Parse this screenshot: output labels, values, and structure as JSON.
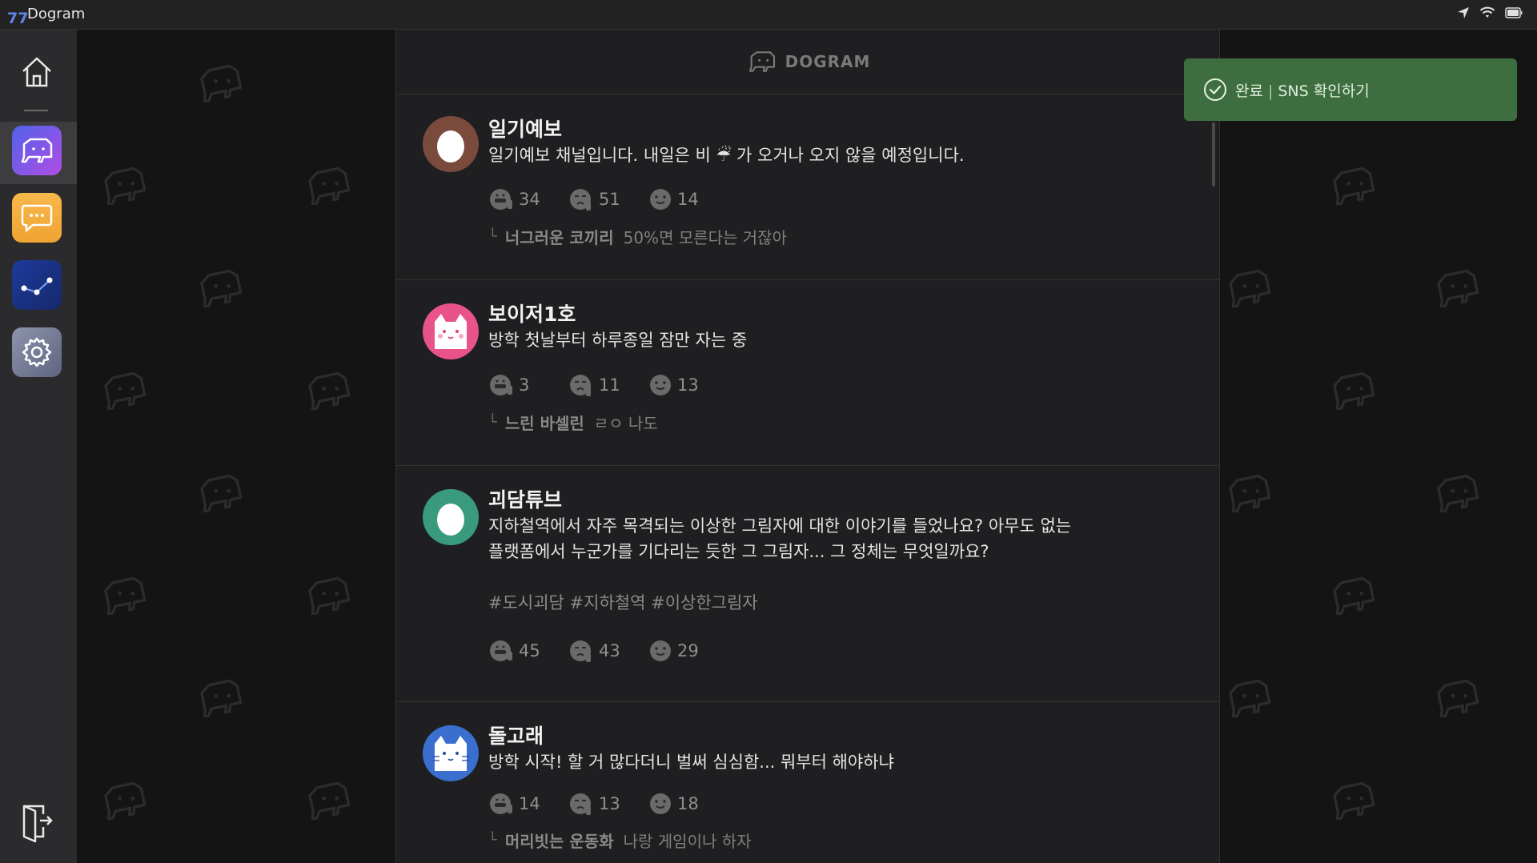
{
  "app": {
    "number": "77",
    "title": "Dogram"
  },
  "status_icons": [
    "location-arrow-icon",
    "wifi-icon",
    "battery-icon"
  ],
  "sidebar": {
    "items": [
      {
        "name": "home",
        "icon": "home-icon"
      },
      {
        "name": "dogram",
        "icon": "dogram-logo-icon",
        "active": true
      },
      {
        "name": "chat",
        "icon": "chat-bubble-icon"
      },
      {
        "name": "constellation",
        "icon": "constellation-icon"
      },
      {
        "name": "settings",
        "icon": "gear-icon"
      },
      {
        "name": "exit",
        "icon": "exit-door-icon"
      }
    ]
  },
  "feed": {
    "logo_text": "DOGRAM",
    "posts": [
      {
        "name": "일기예보",
        "text": "일기예보 채널입니다. 내일은 비 ☔ 가 오거나 오지 않을 예정입니다.",
        "reactions": [
          "34",
          "51",
          "14"
        ],
        "reply": {
          "name": "너그러운 코끼리",
          "text": "50%면 모른다는 거잖아"
        },
        "avatar_color": "#7a4a3c"
      },
      {
        "name": "보이저1호",
        "text": "방학 첫날부터 하루종일 잠만 자는 중",
        "reactions": [
          "3",
          "11",
          "13"
        ],
        "reply": {
          "name": "느린 바셀린",
          "text": "ㄹㅇ 나도"
        },
        "avatar_color": "#e8548a"
      },
      {
        "name": "괴담튜브",
        "text_line1": "지하철역에서 자주 목격되는 이상한 그림자에 대한 이야기를 들었나요? 아무도 없는",
        "text_line2": "플랫폼에서 누군가를 기다리는 듯한 그 그림자... 그 정체는 무엇일까요?",
        "tags": "#도시괴담 #지하철역 #이상한그림자",
        "reactions": [
          "45",
          "43",
          "29"
        ],
        "avatar_color": "#3a9a7e"
      },
      {
        "name": "돌고래",
        "text": "방학 시작! 할 거 많다더니 벌써 심심함... 뭐부터 해야하냐",
        "reactions": [
          "14",
          "13",
          "18"
        ],
        "reply": {
          "name": "머리빗는 운동화",
          "text": "나랑 게임이나 하자"
        },
        "avatar_color": "#3a6fd0"
      }
    ]
  },
  "toast": {
    "status": "완료",
    "separator": "|",
    "message": "SNS 확인하기",
    "color": "#3e6e3f"
  }
}
